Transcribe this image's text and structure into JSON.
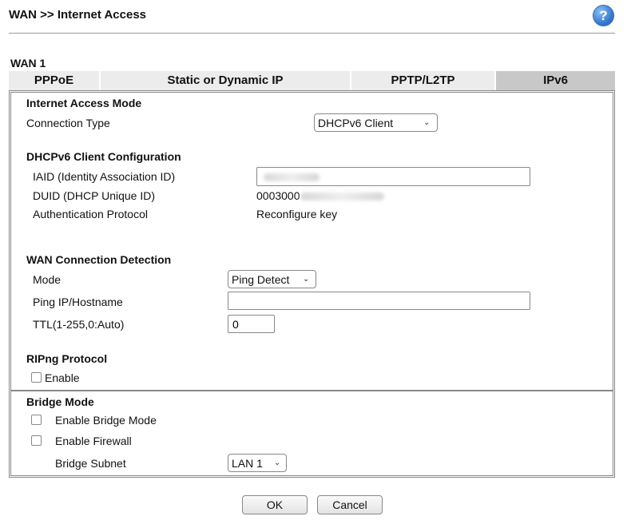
{
  "header": {
    "title": "WAN >> Internet Access",
    "help_icon": "?"
  },
  "wan_label": "WAN 1",
  "tabs": [
    {
      "label": "PPPoE",
      "active": false
    },
    {
      "label": "Static or Dynamic IP",
      "active": false
    },
    {
      "label": "PPTP/L2TP",
      "active": false
    },
    {
      "label": "IPv6",
      "active": true
    }
  ],
  "internet_access": {
    "heading": "Internet Access Mode",
    "connection_type_label": "Connection Type",
    "connection_type_value": "DHCPv6 Client"
  },
  "dhcpv6": {
    "heading": "DHCPv6 Client Configuration",
    "iaid_label": "IAID (Identity Association ID)",
    "iaid_value": "",
    "duid_label": "DUID (DHCP Unique ID)",
    "duid_value": "0003000",
    "auth_label": "Authentication Protocol",
    "auth_value": "Reconfigure key"
  },
  "detection": {
    "heading": "WAN Connection Detection",
    "mode_label": "Mode",
    "mode_value": "Ping Detect",
    "ping_label": "Ping IP/Hostname",
    "ping_value": "",
    "ttl_label": "TTL(1-255,0:Auto)",
    "ttl_value": "0"
  },
  "ripng": {
    "heading": "RIPng Protocol",
    "enable_label": "Enable",
    "enabled": false
  },
  "bridge": {
    "heading": "Bridge Mode",
    "enable_bridge_label": "Enable Bridge Mode",
    "enable_firewall_label": "Enable Firewall",
    "subnet_label": "Bridge Subnet",
    "subnet_value": "LAN 1"
  },
  "buttons": {
    "ok": "OK",
    "cancel": "Cancel"
  },
  "colors": {
    "tab_bg": "#ececec",
    "tab_active_bg": "#c8c8c8",
    "help_icon": "#2d6fc9"
  }
}
